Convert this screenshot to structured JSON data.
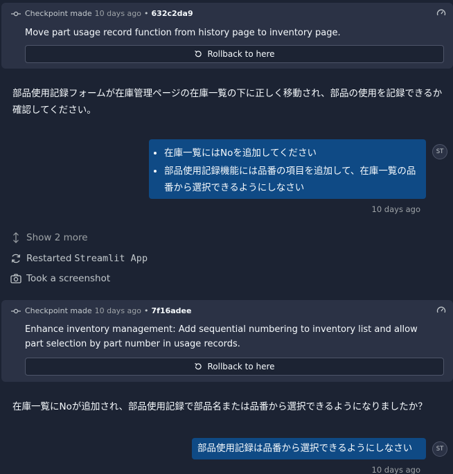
{
  "checkpoint1": {
    "label": "Checkpoint made",
    "time": "10 days ago",
    "separator": "•",
    "hash": "632c2da9",
    "message": "Move part usage record function from history page to inventory page.",
    "rollback_label": "Rollback to here"
  },
  "agent_message1": "部品使用記録フォームが在庫管理ページの在庫一覧の下に正しく移動され、部品の使用を記録できるか確認してください。",
  "user_message1": {
    "items": [
      "在庫一覧にはNoを追加してください",
      "部品使用記録機能には品番の項目を追加して、在庫一覧の品番から選択できるようにしなさい"
    ],
    "avatar": "ST",
    "time": "10 days ago"
  },
  "actions": {
    "show_more": "Show 2 more",
    "restarted_prefix": "Restarted",
    "restarted_app": "Streamlit App",
    "screenshot": "Took a screenshot"
  },
  "checkpoint2": {
    "label": "Checkpoint made",
    "time": "10 days ago",
    "separator": "•",
    "hash": "7f16adee",
    "message": "Enhance inventory management: Add sequential numbering to inventory list and allow part selection by part number in usage records.",
    "rollback_label": "Rollback to here"
  },
  "agent_message2": "在庫一覧にNoが追加され、部品使用記録で部品名または品番から選択できるようになりましたか？",
  "user_message2": {
    "text": "部品使用記録は品番から選択できるようにしなさい",
    "avatar": "ST",
    "time": "10 days ago"
  },
  "colors": {
    "background": "#1c2333",
    "card": "#2b3245",
    "user_bubble": "#0f4a85",
    "text": "#f5f9fc",
    "muted": "#9da2a6"
  }
}
